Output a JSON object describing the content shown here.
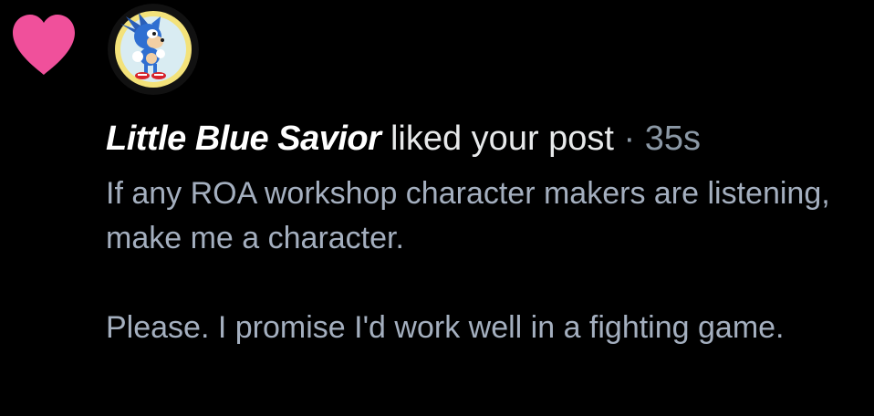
{
  "notification": {
    "type_icon": "heart-icon",
    "heart_color": "#f0509b",
    "avatar_icon": "sonic-avatar",
    "username": "Little Blue Savior",
    "action": "liked your post",
    "separator": "·",
    "timestamp": "35s",
    "post_text": "If any ROA workshop character makers are listening, make me a character.\n\nPlease. I promise I'd work well in a fighting game."
  },
  "colors": {
    "background": "#000000",
    "username": "#ffffff",
    "action_text": "#e7e9ea",
    "timestamp": "#8b98a5",
    "post_text": "#a4afbf",
    "avatar_ring": "#f3e27a"
  }
}
